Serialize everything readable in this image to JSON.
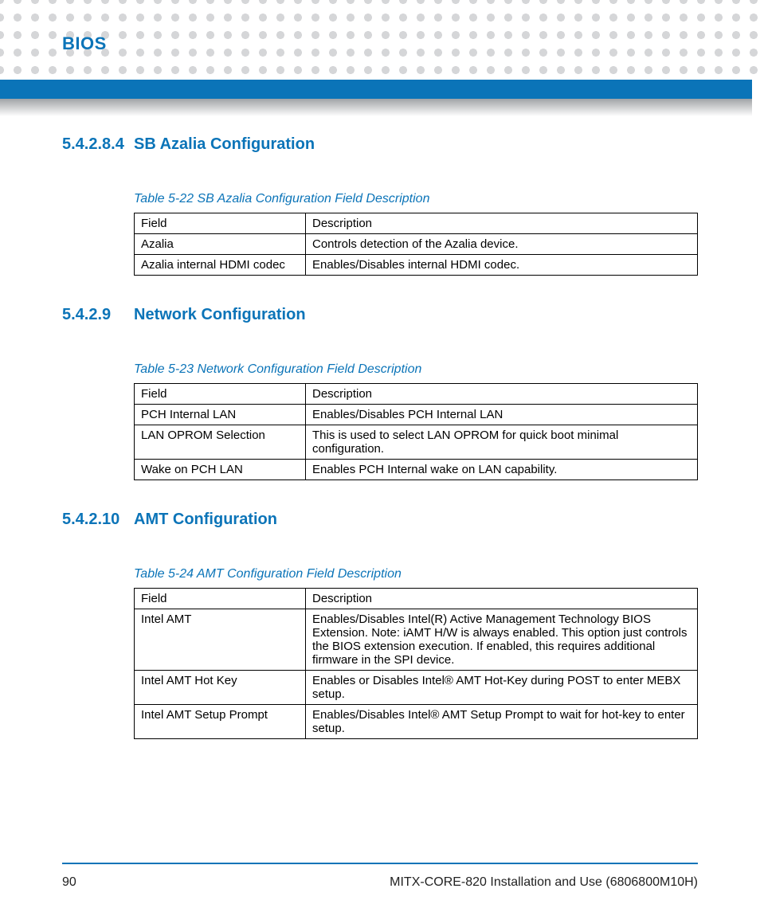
{
  "header": {
    "title": "BIOS"
  },
  "sections": [
    {
      "num": "5.4.2.8.4",
      "title": "SB Azalia Configuration",
      "caption": "Table 5-22 SB Azalia Configuration Field Description",
      "headers": {
        "field": "Field",
        "desc": "Description"
      },
      "rows": [
        {
          "field": "Azalia",
          "desc": "Controls detection of the Azalia device."
        },
        {
          "field": "Azalia internal HDMI codec",
          "desc": "Enables/Disables internal HDMI codec."
        }
      ]
    },
    {
      "num": "5.4.2.9",
      "title": "Network Configuration",
      "caption": "Table 5-23 Network Configuration Field Description",
      "headers": {
        "field": "Field",
        "desc": "Description"
      },
      "rows": [
        {
          "field": "PCH Internal LAN",
          "desc": "Enables/Disables PCH Internal LAN"
        },
        {
          "field": "LAN OPROM Selection",
          "desc": "This is used to select LAN OPROM for quick boot minimal configuration."
        },
        {
          "field": "Wake on PCH LAN",
          "desc": "Enables PCH Internal wake on LAN capability."
        }
      ]
    },
    {
      "num": "5.4.2.10",
      "title": "AMT Configuration",
      "caption": "Table 5-24 AMT Configuration Field Description",
      "headers": {
        "field": "Field",
        "desc": "Description"
      },
      "rows": [
        {
          "field": "Intel AMT",
          "desc": "Enables/Disables Intel(R) Active Management Technology BIOS Extension. Note: iAMT H/W is always enabled. This option just controls the BIOS extension execution. If enabled, this requires additional firmware in the SPI device."
        },
        {
          "field": "Intel AMT Hot Key",
          "desc": "Enables or Disables Intel® AMT Hot-Key during POST to enter MEBX setup."
        },
        {
          "field": "Intel AMT Setup Prompt",
          "desc": "Enables/Disables Intel® AMT Setup Prompt to wait for hot-key to enter setup."
        }
      ]
    }
  ],
  "footer": {
    "page": "90",
    "doc": "MITX-CORE-820 Installation and Use (6806800M10H)"
  }
}
